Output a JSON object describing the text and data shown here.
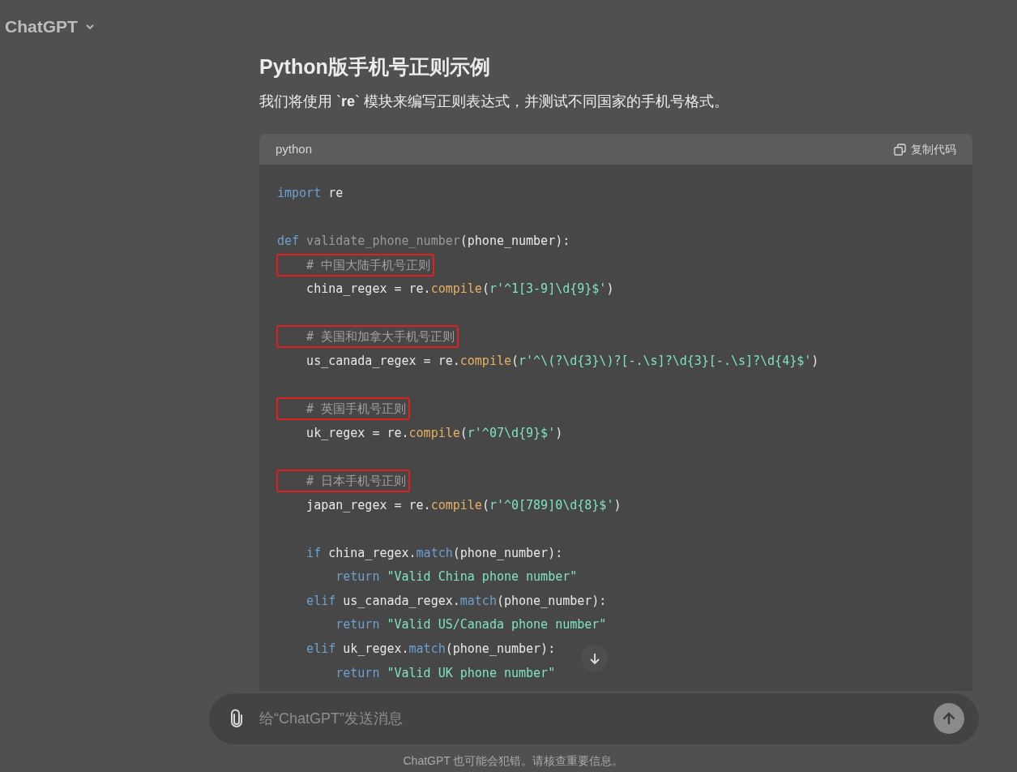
{
  "header": {
    "title": "ChatGPT"
  },
  "message": {
    "heading": "Python版手机号正则示例",
    "intro": "我们将使用 `**re**` 模块来编写正则表达式，并测试不同国家的手机号格式。"
  },
  "code": {
    "language": "python",
    "copy_label": "复制代码",
    "lines": [
      {
        "kind": "code",
        "annotated": false,
        "tokens": [
          {
            "kind": "kw",
            "s": "import"
          },
          {
            "kind": "plain",
            "s": " re"
          }
        ]
      },
      {
        "kind": "blank"
      },
      {
        "kind": "code",
        "annotated": false,
        "tokens": [
          {
            "kind": "kw",
            "s": "def"
          },
          {
            "kind": "name",
            "s": " validate_phone_number"
          },
          {
            "kind": "plain",
            "s": "(phone_number):"
          }
        ]
      },
      {
        "kind": "code",
        "annotated": true,
        "tokens": [
          {
            "kind": "comment",
            "s": "    # 中国大陆手机号正则"
          }
        ]
      },
      {
        "kind": "code",
        "annotated": false,
        "tokens": [
          {
            "kind": "plain",
            "s": "    china_regex = re."
          },
          {
            "kind": "fn",
            "s": "compile"
          },
          {
            "kind": "plain",
            "s": "("
          },
          {
            "kind": "str",
            "s": "r'^1[3-9]\\d{9}$'"
          },
          {
            "kind": "plain",
            "s": ")"
          }
        ]
      },
      {
        "kind": "blank"
      },
      {
        "kind": "code",
        "annotated": true,
        "tokens": [
          {
            "kind": "comment",
            "s": "    # 美国和加拿大手机号正则"
          }
        ]
      },
      {
        "kind": "code",
        "annotated": false,
        "tokens": [
          {
            "kind": "plain",
            "s": "    us_canada_regex = re."
          },
          {
            "kind": "fn",
            "s": "compile"
          },
          {
            "kind": "plain",
            "s": "("
          },
          {
            "kind": "str",
            "s": "r'^\\(?\\d{3}\\)?[-.\\s]?\\d{3}[-.\\s]?\\d{4}$'"
          },
          {
            "kind": "plain",
            "s": ")"
          }
        ]
      },
      {
        "kind": "blank"
      },
      {
        "kind": "code",
        "annotated": true,
        "tokens": [
          {
            "kind": "comment",
            "s": "    # 英国手机号正则"
          }
        ]
      },
      {
        "kind": "code",
        "annotated": false,
        "tokens": [
          {
            "kind": "plain",
            "s": "    uk_regex = re."
          },
          {
            "kind": "fn",
            "s": "compile"
          },
          {
            "kind": "plain",
            "s": "("
          },
          {
            "kind": "str",
            "s": "r'^07\\d{9}$'"
          },
          {
            "kind": "plain",
            "s": ")"
          }
        ]
      },
      {
        "kind": "blank"
      },
      {
        "kind": "code",
        "annotated": true,
        "tokens": [
          {
            "kind": "comment",
            "s": "    # 日本手机号正则"
          }
        ]
      },
      {
        "kind": "code",
        "annotated": false,
        "tokens": [
          {
            "kind": "plain",
            "s": "    japan_regex = re."
          },
          {
            "kind": "fn",
            "s": "compile"
          },
          {
            "kind": "plain",
            "s": "("
          },
          {
            "kind": "str",
            "s": "r'^0[789]0\\d{8}$'"
          },
          {
            "kind": "plain",
            "s": ")"
          }
        ]
      },
      {
        "kind": "blank"
      },
      {
        "kind": "code",
        "annotated": false,
        "tokens": [
          {
            "kind": "kw",
            "s": "    if"
          },
          {
            "kind": "plain",
            "s": " china_regex."
          },
          {
            "kind": "method",
            "s": "match"
          },
          {
            "kind": "plain",
            "s": "(phone_number):"
          }
        ]
      },
      {
        "kind": "code",
        "annotated": false,
        "tokens": [
          {
            "kind": "kw",
            "s": "        return"
          },
          {
            "kind": "str",
            "s": " \"Valid China phone number\""
          }
        ]
      },
      {
        "kind": "code",
        "annotated": false,
        "tokens": [
          {
            "kind": "kw",
            "s": "    elif"
          },
          {
            "kind": "plain",
            "s": " us_canada_regex."
          },
          {
            "kind": "method",
            "s": "match"
          },
          {
            "kind": "plain",
            "s": "(phone_number):"
          }
        ]
      },
      {
        "kind": "code",
        "annotated": false,
        "tokens": [
          {
            "kind": "kw",
            "s": "        return"
          },
          {
            "kind": "str",
            "s": " \"Valid US/Canada phone number\""
          }
        ]
      },
      {
        "kind": "code",
        "annotated": false,
        "tokens": [
          {
            "kind": "kw",
            "s": "    elif"
          },
          {
            "kind": "plain",
            "s": " uk_regex."
          },
          {
            "kind": "method",
            "s": "match"
          },
          {
            "kind": "plain",
            "s": "(phone_number):"
          }
        ]
      },
      {
        "kind": "code",
        "annotated": false,
        "tokens": [
          {
            "kind": "kw",
            "s": "        return"
          },
          {
            "kind": "str",
            "s": " \"Valid UK phone number\""
          }
        ]
      }
    ]
  },
  "composer": {
    "placeholder": "给“ChatGPT”发送消息"
  },
  "footer": "ChatGPT 也可能会犯错。请核查重要信息。"
}
